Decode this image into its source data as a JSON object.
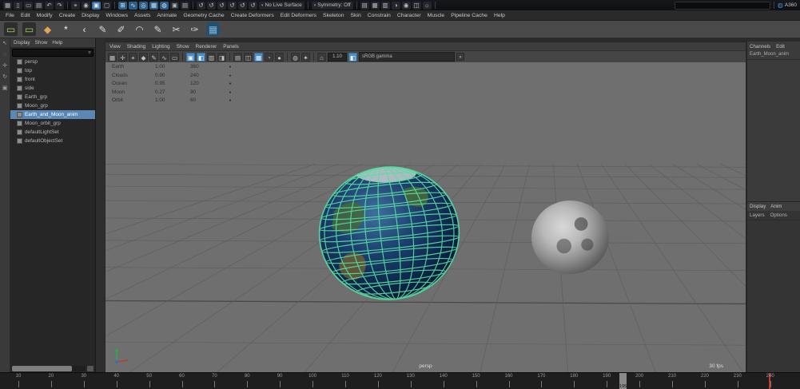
{
  "colors": {
    "selection": "#5b87b5",
    "wireframe": "#58dfa2",
    "accent_blue": "#4d8fc4"
  },
  "status_bar": {
    "items": [
      {
        "t": "icon",
        "name": "menu-grid-icon",
        "g": "▦"
      },
      {
        "t": "icon",
        "name": "new-scene-icon",
        "g": "▯"
      },
      {
        "t": "icon",
        "name": "open-scene-icon",
        "g": "▭"
      },
      {
        "t": "icon",
        "name": "save-scene-icon",
        "g": "▤"
      },
      {
        "t": "icon",
        "name": "undo-icon",
        "g": "↶"
      },
      {
        "t": "icon",
        "name": "redo-icon",
        "g": "↷"
      },
      {
        "t": "sep"
      },
      {
        "t": "icon",
        "name": "select-mask-icon",
        "g": "⌖"
      },
      {
        "t": "icon",
        "name": "hierarchy-mode-icon",
        "g": "◉"
      },
      {
        "t": "icon",
        "name": "object-mode-icon",
        "g": "▣",
        "on": true
      },
      {
        "t": "icon",
        "name": "component-mode-icon",
        "g": "▢"
      },
      {
        "t": "sep"
      },
      {
        "t": "icon",
        "name": "snap-grid-icon",
        "g": "⊞",
        "blue": true
      },
      {
        "t": "icon",
        "name": "snap-curve-icon",
        "g": "∿",
        "blue": true
      },
      {
        "t": "icon",
        "name": "snap-point-icon",
        "g": "◎",
        "blue": true
      },
      {
        "t": "icon",
        "name": "snap-plane-icon",
        "g": "▦",
        "blue": true
      },
      {
        "t": "icon",
        "name": "make-live-icon",
        "g": "◍",
        "blue": true
      },
      {
        "t": "icon",
        "name": "input-connections-icon",
        "g": "▣"
      },
      {
        "t": "icon",
        "name": "output-connections-icon",
        "g": "▤"
      },
      {
        "t": "sep"
      },
      {
        "t": "icon",
        "name": "history-toggle-1-icon",
        "g": "↺"
      },
      {
        "t": "icon",
        "name": "history-toggle-2-icon",
        "g": "↺"
      },
      {
        "t": "icon",
        "name": "history-toggle-3-icon",
        "g": "↺"
      },
      {
        "t": "icon",
        "name": "history-toggle-4-icon",
        "g": "↺"
      },
      {
        "t": "icon",
        "name": "history-toggle-5-icon",
        "g": "↺"
      },
      {
        "t": "icon",
        "name": "history-toggle-6-icon",
        "g": "↺"
      },
      {
        "t": "dd",
        "name": "live-surface-dropdown",
        "label": "No Live Surface"
      },
      {
        "t": "sep"
      },
      {
        "t": "dd",
        "name": "symmetry-dropdown",
        "label": "Symmetry: Off"
      },
      {
        "t": "sep"
      },
      {
        "t": "icon",
        "name": "render-view-icon",
        "g": "▤"
      },
      {
        "t": "icon",
        "name": "render-current-frame-icon",
        "g": "▦"
      },
      {
        "t": "icon",
        "name": "ipr-render-icon",
        "g": "▥"
      },
      {
        "t": "icon",
        "name": "render-settings-icon",
        "g": "◑"
      },
      {
        "t": "icon",
        "name": "hypershade-icon",
        "g": "◉"
      },
      {
        "t": "icon",
        "name": "render-sequence-icon",
        "g": "◫"
      },
      {
        "t": "icon",
        "name": "light-editor-icon",
        "g": "☼"
      },
      {
        "t": "sep"
      },
      {
        "t": "flex"
      },
      {
        "t": "input",
        "name": "quick-search-field"
      },
      {
        "t": "sep"
      },
      {
        "t": "badge",
        "name": "a360-badge",
        "g": "◍",
        "label": "A360"
      }
    ]
  },
  "menu_bar": {
    "items": [
      "File",
      "Edit",
      "Modify",
      "Create",
      "Display",
      "Windows",
      "Assets",
      "Animate",
      "Geometry Cache",
      "Create Deformers",
      "Edit Deformers",
      "Skeleton",
      "Skin",
      "Constrain",
      "Character",
      "Muscle",
      "Pipeline Cache",
      "Help"
    ]
  },
  "shelf": {
    "icons": [
      {
        "name": "camera-keyframe-icon",
        "g": "▭",
        "c": "#9fd468",
        "bg": "#2e2e2e"
      },
      {
        "name": "camera-aim-icon",
        "g": "▭",
        "c": "#9fd468",
        "bg": "#2e2e2e"
      },
      {
        "name": "set-key-icon",
        "g": "◆",
        "c": "#e3a455",
        "bg": "transparent"
      },
      {
        "name": "star-primitive-icon",
        "g": "*",
        "c": "#f0f0f0",
        "bg": "transparent"
      },
      {
        "name": "angle-tool-icon",
        "g": "‹",
        "c": "#e8e8e8",
        "bg": "transparent"
      },
      {
        "name": "curve-tool-icon",
        "g": "✎",
        "c": "#d8d8d8",
        "bg": "transparent"
      },
      {
        "name": "pencil-curve-icon",
        "g": "✐",
        "c": "#d8d8d8",
        "bg": "transparent"
      },
      {
        "name": "arc-tool-icon",
        "g": "◠",
        "c": "#d8d8d8",
        "bg": "transparent"
      },
      {
        "name": "pen-tool-icon",
        "g": "✎",
        "c": "#d8d8d8",
        "bg": "transparent"
      },
      {
        "name": "cut-tool-icon",
        "g": "✂",
        "c": "#d8d8d8",
        "bg": "transparent"
      },
      {
        "name": "brush-tool-icon",
        "g": "✑",
        "c": "#d8d8d8",
        "bg": "transparent"
      },
      {
        "name": "playblast-monitor-icon",
        "g": "▦",
        "c": "#7fb3d5",
        "bg": "#24506e"
      }
    ]
  },
  "toolbox": {
    "icons": [
      {
        "name": "select-tool-icon",
        "g": "↖"
      },
      {
        "name": "lasso-tool-icon",
        "g": "◌"
      },
      {
        "name": "move-tool-icon",
        "g": "✛"
      },
      {
        "name": "rotate-tool-icon",
        "g": "↻"
      },
      {
        "name": "scale-tool-icon",
        "g": "▣"
      }
    ]
  },
  "outliner": {
    "menus": [
      "Display",
      "Show",
      "Help"
    ],
    "search_placeholder": "",
    "items": [
      {
        "label": "persp",
        "selected": false
      },
      {
        "label": "top",
        "selected": false
      },
      {
        "label": "front",
        "selected": false
      },
      {
        "label": "side",
        "selected": false
      },
      {
        "label": "Earth_grp",
        "selected": false
      },
      {
        "label": "Moon_grp",
        "selected": false
      },
      {
        "label": "Earth_and_Moon_anim",
        "selected": true
      },
      {
        "label": "Moon_orbit_grp",
        "selected": false
      },
      {
        "label": "defaultLightSet",
        "selected": false
      },
      {
        "label": "defaultObjectSet",
        "selected": false
      }
    ]
  },
  "viewport": {
    "menus": [
      "View",
      "Shading",
      "Lighting",
      "Show",
      "Renderer",
      "Panels"
    ],
    "toolbar": {
      "icons": [
        {
          "name": "select-icon",
          "g": "▦"
        },
        {
          "name": "move-icon",
          "g": "✛"
        },
        {
          "name": "snap-icon",
          "g": "⌖"
        },
        {
          "name": "key-icon",
          "g": "◆"
        },
        {
          "name": "pencil-icon",
          "g": "✎"
        },
        {
          "name": "curve-icon",
          "g": "∿"
        },
        {
          "name": "frame-icon",
          "g": "▭"
        },
        {
          "t": "sep"
        },
        {
          "name": "wireframe-icon",
          "g": "▣",
          "on": true
        },
        {
          "name": "shaded-icon",
          "g": "◧",
          "on": true
        },
        {
          "name": "textured-icon",
          "g": "▥"
        },
        {
          "name": "lights-icon",
          "g": "◨"
        },
        {
          "t": "sep"
        },
        {
          "name": "shadows-icon",
          "g": "▤"
        },
        {
          "name": "screenspace-ao-icon",
          "g": "◫"
        },
        {
          "name": "multisample-icon",
          "g": "▦",
          "on": true
        },
        {
          "name": "depth-of-field-icon",
          "g": "◔"
        },
        {
          "name": "motion-blur-icon",
          "g": "●"
        },
        {
          "t": "sep"
        },
        {
          "name": "isolate-select-icon",
          "g": "◍"
        },
        {
          "name": "xray-icon",
          "g": "✦"
        },
        {
          "t": "sep"
        },
        {
          "name": "home-view-icon",
          "g": "⌂"
        }
      ],
      "gamma": "1.10",
      "view_transform": "sRGB gamma"
    },
    "hud_table": {
      "rows": [
        {
          "name": "Earth",
          "v1": "1.00",
          "v2": "360",
          "dot": "●"
        },
        {
          "name": "Clouds",
          "v1": "0.90",
          "v2": "240",
          "dot": "●"
        },
        {
          "name": "Ocean",
          "v1": "0.95",
          "v2": "120",
          "dot": "●"
        },
        {
          "name": "Moon",
          "v1": "0.27",
          "v2": "90",
          "dot": "●"
        },
        {
          "name": "Orbit",
          "v1": "1.00",
          "v2": "60",
          "dot": "●"
        }
      ]
    },
    "camera_label": "persp",
    "fps_label": "30 fps"
  },
  "channel_box": {
    "menus": [
      "Channels",
      "Edit"
    ],
    "object_name": "Earth_Moon_anim"
  },
  "layer_editor": {
    "tabs": [
      "Display",
      "Anim"
    ],
    "menus": [
      "Layers",
      "Options"
    ]
  },
  "timeline": {
    "labels": [
      "10",
      "20",
      "30",
      "40",
      "50",
      "60",
      "70",
      "80",
      "90",
      "100",
      "110",
      "120",
      "130",
      "140",
      "150",
      "160",
      "170",
      "180",
      "190",
      "200",
      "210",
      "220",
      "230",
      "240"
    ],
    "current_frame": "195"
  }
}
